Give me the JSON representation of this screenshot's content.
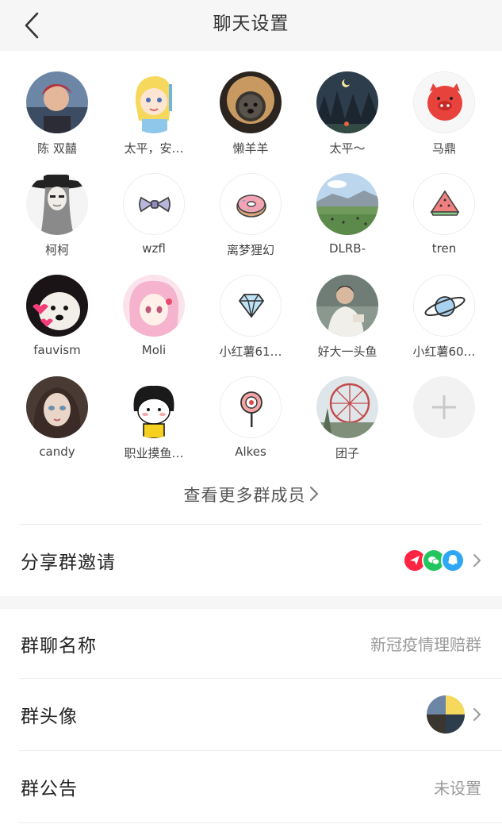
{
  "header": {
    "title": "聊天设置"
  },
  "members": [
    {
      "name": "陈 双囍",
      "avatar": "photo-man-red-hair"
    },
    {
      "name": "太平，安…",
      "avatar": "cartoon-alice"
    },
    {
      "name": "懒羊羊",
      "avatar": "dog-photo"
    },
    {
      "name": "太平～",
      "avatar": "night-landscape"
    },
    {
      "name": "马鼎",
      "avatar": "pig-icon"
    },
    {
      "name": "柯柯",
      "avatar": "sketch-girl-hat"
    },
    {
      "name": "wzfl",
      "avatar": "bow-icon"
    },
    {
      "name": "离梦狸幻",
      "avatar": "donut-icon"
    },
    {
      "name": "DLRB-",
      "avatar": "grassland-photo"
    },
    {
      "name": "tren",
      "avatar": "watermelon-icon"
    },
    {
      "name": "fauvism",
      "avatar": "dog-hearts-photo"
    },
    {
      "name": "Moli",
      "avatar": "anime-pink-girl"
    },
    {
      "name": "小红薯61…",
      "avatar": "diamond-icon"
    },
    {
      "name": "好大一头鱼",
      "avatar": "man-white-shirt-photo"
    },
    {
      "name": "小红薯60…",
      "avatar": "planet-icon"
    },
    {
      "name": "candy",
      "avatar": "girl-portrait"
    },
    {
      "name": "职业摸鱼…",
      "avatar": "cartoon-girl-yellow"
    },
    {
      "name": "Alkes",
      "avatar": "lollipop-icon"
    },
    {
      "name": "团子",
      "avatar": "ferris-wheel-photo"
    }
  ],
  "add_member": {
    "icon": "plus-icon"
  },
  "more_members_label": "查看更多群成员",
  "share": {
    "label": "分享群邀请",
    "icons": [
      "share-app-icon",
      "wechat-icon",
      "qq-icon"
    ]
  },
  "settings": {
    "group_name_label": "群聊名称",
    "group_name_value": "新冠疫情理赔群",
    "group_avatar_label": "群头像",
    "group_notice_label": "群公告",
    "group_notice_value": "未设置"
  },
  "colors": {
    "header_bg": "#f6f6f6",
    "share_red": "#ff2442",
    "wechat_green": "#22c55e",
    "qq_blue": "#2ea8f5"
  }
}
